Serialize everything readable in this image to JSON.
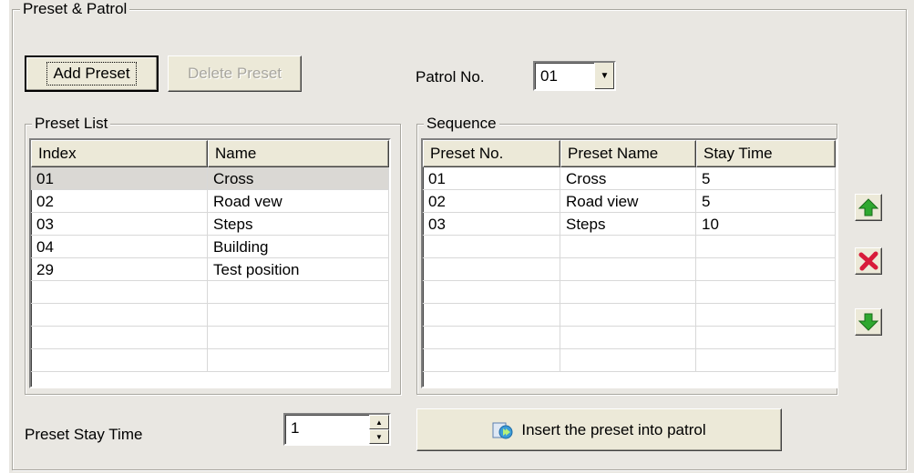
{
  "group": {
    "title": "Preset & Patrol"
  },
  "buttons": {
    "add_preset": "Add Preset",
    "delete_preset": "Delete Preset",
    "insert": "Insert the preset into patrol"
  },
  "patrol": {
    "label": "Patrol No.",
    "value": "01"
  },
  "preset_list": {
    "title": "Preset List",
    "columns": [
      "Index",
      "Name"
    ],
    "rows": [
      [
        "01",
        "Cross"
      ],
      [
        "02",
        "Road vew"
      ],
      [
        "03",
        "Steps"
      ],
      [
        "04",
        "Building"
      ],
      [
        "29",
        "Test position"
      ]
    ],
    "selected_row": 0
  },
  "sequence": {
    "title": "Sequence",
    "columns": [
      "Preset No.",
      "Preset Name",
      "Stay Time"
    ],
    "rows": [
      [
        "01",
        "Cross",
        "5"
      ],
      [
        "02",
        "Road view",
        "5"
      ],
      [
        "03",
        "Steps",
        "10"
      ]
    ]
  },
  "stay_time": {
    "label": "Preset Stay Time",
    "value": "1"
  },
  "icons": {
    "up": "arrow-up-icon",
    "delete": "red-x-icon",
    "down": "arrow-down-icon",
    "insert": "insert-icon"
  },
  "colors": {
    "green_arrow": "#2fa82f",
    "red_x": "#d81b3a",
    "panel_bg": "#e9e7e2"
  }
}
